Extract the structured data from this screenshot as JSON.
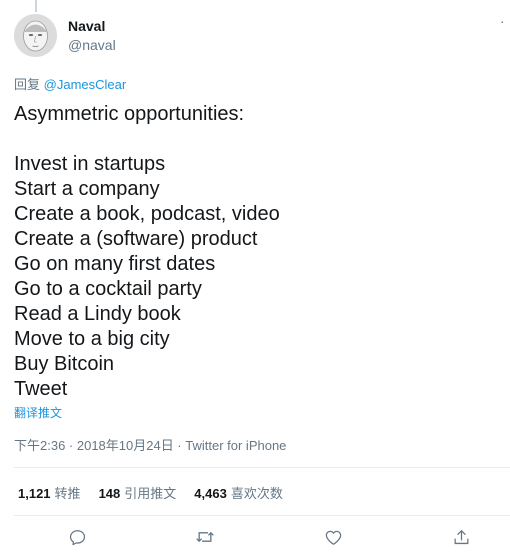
{
  "author": {
    "name": "Naval",
    "handle": "@naval"
  },
  "reply": {
    "prefix": "回复",
    "to": "@JamesClear"
  },
  "tweet": {
    "lines": [
      "Asymmetric opportunities:",
      "",
      "Invest in startups",
      "Start a company",
      "Create a book, podcast, video",
      "Create a (software) product",
      "Go on many first dates",
      "Go to a cocktail party",
      "Read a Lindy book",
      "Move to a big city",
      "Buy Bitcoin",
      "Tweet"
    ],
    "translate_label": "翻译推文",
    "timestamp": "下午2:36 · 2018年10月24日 · Twitter for iPhone"
  },
  "stats": {
    "retweets": {
      "count": "1,121",
      "label": "转推"
    },
    "quotes": {
      "count": "148",
      "label": "引用推文"
    },
    "likes": {
      "count": "4,463",
      "label": "喜欢次数"
    }
  },
  "actions": {
    "icons": [
      "reply-icon",
      "retweet-icon",
      "like-icon",
      "share-icon"
    ]
  },
  "colors": {
    "link": "#1b95e0",
    "text": "#14171a",
    "secondary": "#657786",
    "divider": "#e6ecf0"
  }
}
